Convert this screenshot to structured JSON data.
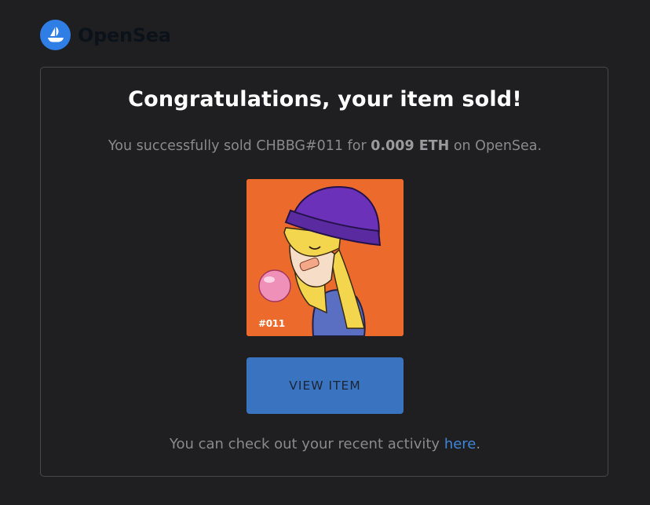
{
  "header": {
    "brand": "OpenSea",
    "logo_icon": "opensea-ship-icon",
    "logo_color": "#2f7ee5"
  },
  "card": {
    "title": "Congratulations, your item sold!",
    "message": {
      "prefix": "You successfully sold CHBBG#011 for ",
      "price": "0.009 ETH",
      "suffix": " on OpenSea."
    },
    "nft": {
      "tag": "#011",
      "background_color": "#ec6a2b"
    },
    "button": {
      "label": "VIEW ITEM",
      "color": "#3a74c1"
    },
    "footer": {
      "prefix": "You can check out your recent activity ",
      "link_label": "here",
      "suffix": "."
    }
  }
}
